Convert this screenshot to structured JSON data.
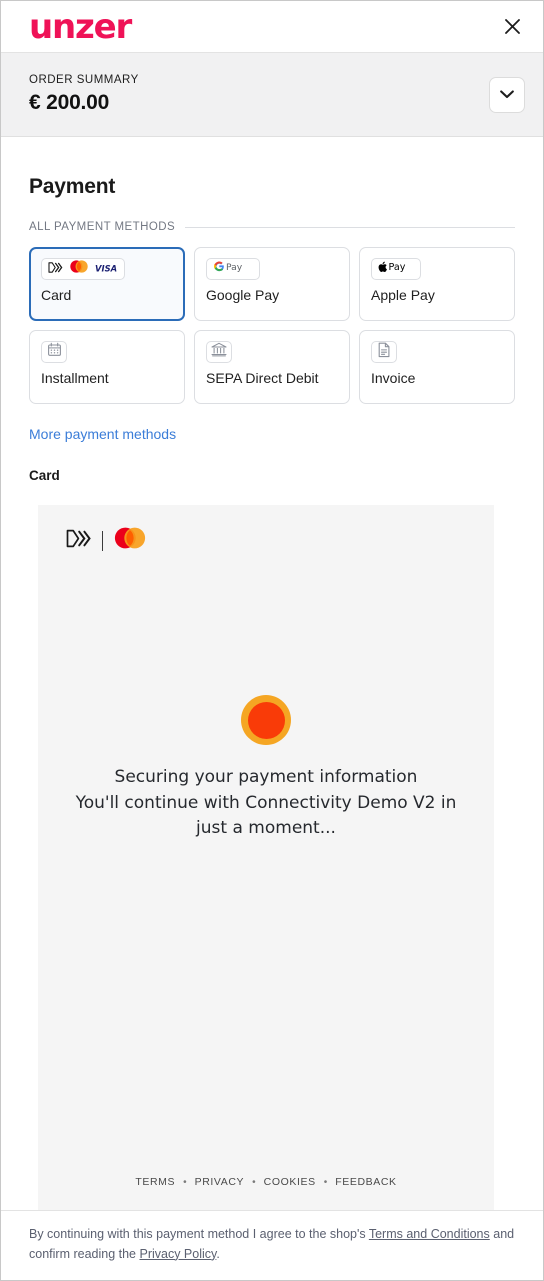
{
  "header": {
    "logo_text": "unzer",
    "logo_color": "#ef1257",
    "close_icon": "close-icon"
  },
  "order_summary": {
    "label": "ORDER SUMMARY",
    "amount": "€ 200.00",
    "toggle_icon": "chevron-down-icon"
  },
  "main": {
    "title": "Payment",
    "section_label": "ALL PAYMENT METHODS",
    "more_link": "More payment methods",
    "selected_method_heading": "Card",
    "payment_methods": [
      {
        "label": "Card",
        "selected": true,
        "brands": [
          "contactless-icon",
          "mastercard-icon",
          "visa-icon"
        ]
      },
      {
        "label": "Google Pay",
        "selected": false,
        "brands": [
          "google-pay-icon"
        ]
      },
      {
        "label": "Apple Pay",
        "selected": false,
        "brands": [
          "apple-pay-icon"
        ]
      },
      {
        "label": "Installment",
        "selected": false,
        "brands": [
          "calendar-icon"
        ]
      },
      {
        "label": "SEPA Direct Debit",
        "selected": false,
        "brands": [
          "bank-icon"
        ]
      },
      {
        "label": "Invoice",
        "selected": false,
        "brands": [
          "document-icon"
        ]
      }
    ]
  },
  "pay_frame": {
    "brands": [
      "contactless-icon",
      "mastercard-icon"
    ],
    "spinner": {
      "ring_color": "#f5a623",
      "core_color": "#f93b08"
    },
    "securing_title": "Securing your payment information",
    "securing_subtitle": "You'll continue with Connectivity Demo V2 in just a moment...",
    "footer_links": [
      "TERMS",
      "PRIVACY",
      "COOKIES",
      "FEEDBACK"
    ],
    "footer_separator": "•"
  },
  "disclaimer": {
    "text_before": "By continuing with this payment method I agree to the shop's ",
    "terms_link": "Terms and Conditions",
    "text_middle": " and confirm reading the ",
    "privacy_link": "Privacy Policy",
    "text_after": "."
  }
}
